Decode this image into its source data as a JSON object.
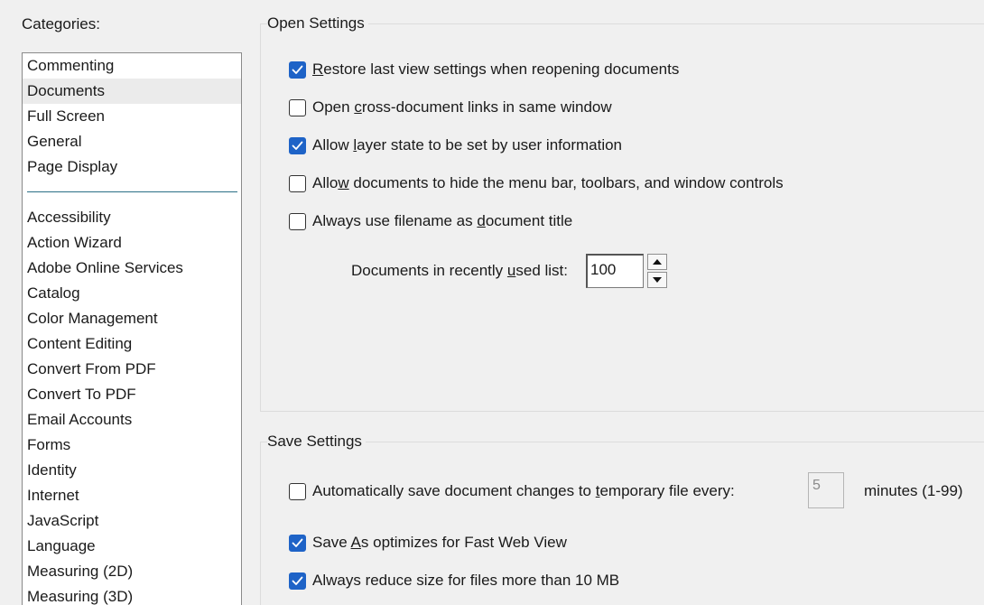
{
  "categories": {
    "heading": "Categories:",
    "selected": "Documents",
    "group_top": [
      "Commenting",
      "Documents",
      "Full Screen",
      "General",
      "Page Display"
    ],
    "group_bottom": [
      "Accessibility",
      "Action Wizard",
      "Adobe Online Services",
      "Catalog",
      "Color Management",
      "Content Editing",
      "Convert From PDF",
      "Convert To PDF",
      "Email Accounts",
      "Forms",
      "Identity",
      "Internet",
      "JavaScript",
      "Language",
      "Measuring (2D)",
      "Measuring (3D)"
    ]
  },
  "open_settings": {
    "title": "Open Settings",
    "checkboxes": [
      {
        "pre": "",
        "u": "R",
        "post": "estore last view settings when reopening documents",
        "checked": true
      },
      {
        "pre": "Open ",
        "u": "c",
        "post": "ross-document links in same window",
        "checked": false
      },
      {
        "pre": "Allow ",
        "u": "l",
        "post": "ayer state to be set by user information",
        "checked": true
      },
      {
        "pre": "Allo",
        "u": "w",
        "post": " documents to hide the menu bar, toolbars, and window controls",
        "checked": false
      },
      {
        "pre": "Always use filename as ",
        "u": "d",
        "post": "ocument title",
        "checked": false
      }
    ],
    "recent_list": {
      "pre": "Documents in recently ",
      "u": "u",
      "post": "sed list:",
      "value": "100"
    }
  },
  "save_settings": {
    "title": "Save Settings",
    "autosave": {
      "pre": "Automatically save document changes to ",
      "u": "t",
      "post": "emporary file every:",
      "checked": false,
      "minutes_value": "5",
      "minutes_label": "minutes (1-99)"
    },
    "checkboxes": [
      {
        "pre": "Save ",
        "u": "A",
        "post": "s optimizes for Fast Web View",
        "checked": true
      },
      {
        "pre": "Always reduce size for files more than 10 MB",
        "u": "",
        "post": "",
        "checked": true
      }
    ]
  },
  "colors": {
    "accent": "#1e63c7",
    "selection": "#ebebeb",
    "separator": "#2a6f86"
  }
}
